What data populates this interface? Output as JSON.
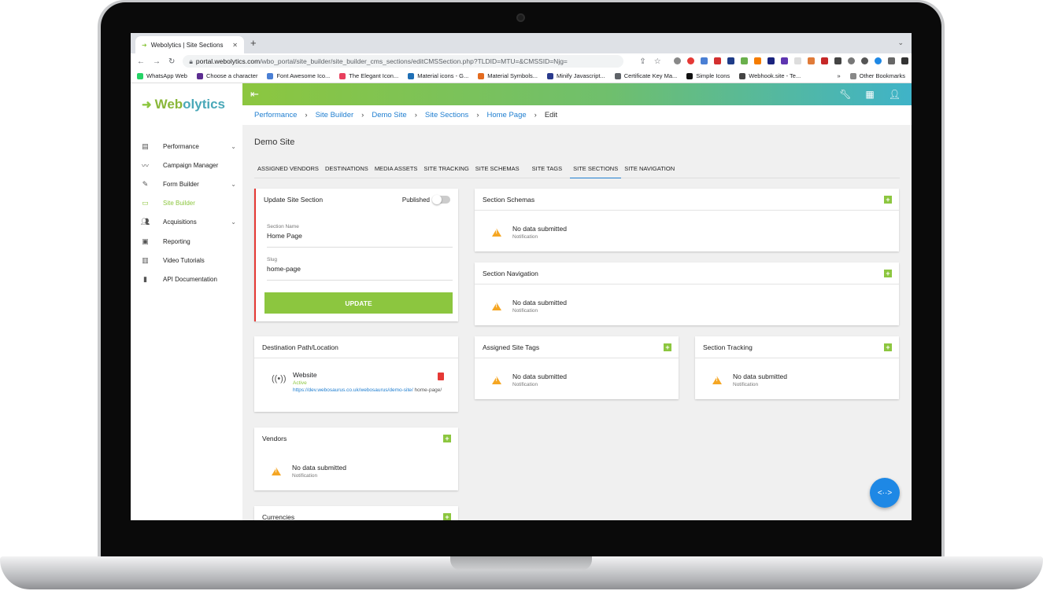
{
  "browser": {
    "tab_title": "Webolytics | Site Sections",
    "url_domain": "portal.webolytics.com",
    "url_path": "/wbo_portal/site_builder/site_builder_cms_sections/editCMSSection.php?TLDID=MTU=&CMSSID=Njg=",
    "bookmarks": [
      "WhatsApp Web",
      "Choose a character",
      "Font Awesome Ico...",
      "The Elegant Icon...",
      "Material icons - G...",
      "Material Symbols...",
      "Minify Javascript...",
      "Certificate Key Ma...",
      "Simple Icons",
      "Webhook.site - Te..."
    ],
    "bookmark_colors": [
      "#25d366",
      "#5c2d91",
      "#4a7fd4",
      "#e8405e",
      "#1f6fb5",
      "#e36b1f",
      "#2a3a8c",
      "#5f6368",
      "#111111",
      "#444444"
    ],
    "other_bookmarks": "Other Bookmarks",
    "more": "»"
  },
  "logo": {
    "part1": "Web",
    "part2": "olytics"
  },
  "sidebar": {
    "items": [
      {
        "label": "Performance",
        "icon": "dashboard-icon",
        "caret": "⌄"
      },
      {
        "label": "Campaign Manager",
        "icon": "trend-icon",
        "caret": ""
      },
      {
        "label": "Form Builder",
        "icon": "form-icon",
        "caret": "⌄"
      },
      {
        "label": "Site Builder",
        "icon": "site-icon",
        "caret": ""
      },
      {
        "label": "Acquisitions",
        "icon": "people-icon",
        "caret": "⌄"
      },
      {
        "label": "Reporting",
        "icon": "report-icon",
        "caret": ""
      },
      {
        "label": "Video Tutorials",
        "icon": "video-icon",
        "caret": ""
      },
      {
        "label": "API Documentation",
        "icon": "book-icon",
        "caret": ""
      }
    ]
  },
  "breadcrumb": [
    "Performance",
    "Site Builder",
    "Demo Site",
    "Site Sections",
    "Home Page",
    "Edit"
  ],
  "page_title": "Demo Site",
  "subtabs": [
    "ASSIGNED VENDORS",
    "DESTINATIONS",
    "MEDIA ASSETS",
    "SITE TRACKING",
    "SITE SCHEMAS",
    "SITE TAGS",
    "SITE SECTIONS",
    "SITE NAVIGATION"
  ],
  "update": {
    "title": "Update Site Section",
    "published": "Published",
    "name_label": "Section Name",
    "name_value": "Home Page",
    "slug_label": "Slug",
    "slug_value": "home-page",
    "button": "UPDATE"
  },
  "destination": {
    "title": "Destination Path/Location",
    "name": "Website",
    "status": "Active",
    "link": "https://dev.webosaurus.co.uk/webosaurus/demo-site/",
    "rest": " home-page/"
  },
  "empty": {
    "main": "No data submitted",
    "sub": "Notification"
  },
  "cards": {
    "schemas": "Section Schemas",
    "navigation": "Section Navigation",
    "tags": "Assigned Site Tags",
    "tracking": "Section Tracking",
    "vendors": "Vendors",
    "currencies": "Currencies"
  },
  "colors": {
    "accent": "#8cc63f",
    "link": "#1f7ed0",
    "warning": "#f5a623"
  }
}
